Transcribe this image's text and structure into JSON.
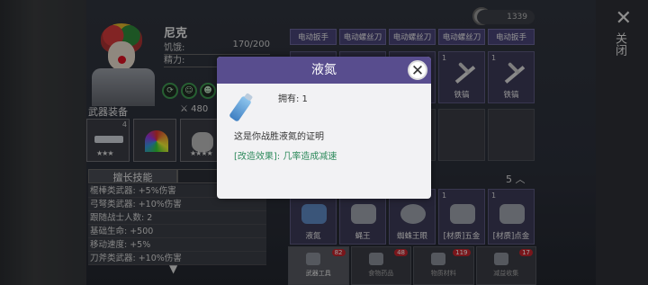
{
  "character": {
    "name": "尼克",
    "stats": [
      {
        "label": "饥饿:",
        "value": "170/200"
      },
      {
        "label": "精力:",
        "value": ""
      }
    ]
  },
  "weapons": {
    "title": "武器装备",
    "power": "480",
    "slot1_count": "4",
    "slot1_stars": "★★★",
    "slot3_stars": "★★★★"
  },
  "skills": {
    "tabs": [
      "擅长技能",
      "积"
    ],
    "list": [
      "棍棒类武器: +5%伤害",
      "弓弩类武器: +10%伤害",
      "跟随战士人数: 2",
      "基础生命: +500",
      "移动速度: +5%",
      "刀斧类武器: +10%伤害"
    ]
  },
  "currency": {
    "value": "1339"
  },
  "items": {
    "headers": [
      "电动扳手",
      "电动螺丝刀",
      "电动螺丝刀",
      "电动螺丝刀",
      "电动扳手"
    ],
    "row2": [
      {
        "num": "",
        "label": ""
      },
      {
        "num": "",
        "label": ""
      },
      {
        "num": "",
        "label": ""
      },
      {
        "num": "1",
        "label": "铁镐"
      },
      {
        "num": "1",
        "label": "铁镐"
      }
    ],
    "page_count": "5",
    "bottom": [
      {
        "num": "",
        "label": "液氮"
      },
      {
        "num": "1",
        "label": "蝇王"
      },
      {
        "num": "1",
        "label": "蜘蛛王眼"
      },
      {
        "num": "1",
        "label": "[材质]五金"
      },
      {
        "num": "1",
        "label": "[材质]点金"
      }
    ]
  },
  "tabs": [
    {
      "label": "武器工具",
      "badge": "82"
    },
    {
      "label": "食物药品",
      "badge": "48"
    },
    {
      "label": "物质材料",
      "badge": "119"
    },
    {
      "label": "减益收集",
      "badge": "17"
    }
  ],
  "sidebar": {
    "close_icon": "✕",
    "label": "关闭"
  },
  "modal": {
    "title": "液氮",
    "own": "拥有: 1",
    "description": "这是你战胜液氮的证明",
    "effect": "[改造效果]: 几率造成减速",
    "close_icon": "✕"
  }
}
